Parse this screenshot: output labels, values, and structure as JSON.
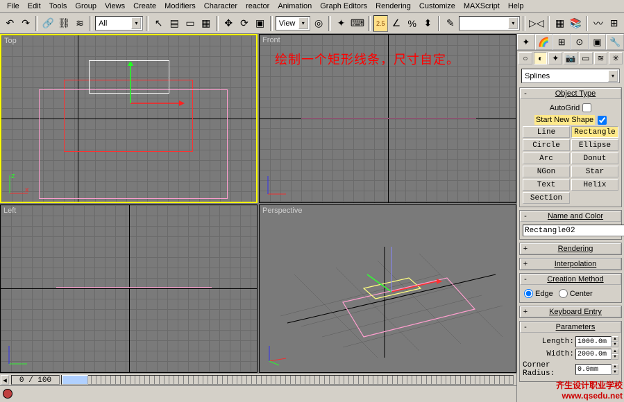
{
  "menu": [
    "File",
    "Edit",
    "Tools",
    "Group",
    "Views",
    "Create",
    "Modifiers",
    "Character",
    "reactor",
    "Animation",
    "Graph Editors",
    "Rendering",
    "Customize",
    "MAXScript",
    "Help"
  ],
  "toolbar": {
    "selset_label": "All",
    "view_label": "View",
    "snap_text": "2.5"
  },
  "viewports": {
    "top": "Top",
    "front": "Front",
    "left": "Left",
    "persp": "Perspective"
  },
  "annotation": "绘制一个矩形线条，尺寸自定。",
  "panel": {
    "category": "Splines",
    "object_type": "Object Type",
    "autogrid": "AutoGrid",
    "start_new_shape": "Start New Shape",
    "buttons": [
      [
        "Line",
        "Rectangle"
      ],
      [
        "Circle",
        "Ellipse"
      ],
      [
        "Arc",
        "Donut"
      ],
      [
        "NGon",
        "Star"
      ],
      [
        "Text",
        "Helix"
      ],
      [
        "Section",
        ""
      ]
    ],
    "selected_button": "Rectangle",
    "name_and_color": "Name and Color",
    "object_name": "Rectangle02",
    "rendering": "Rendering",
    "interpolation": "Interpolation",
    "creation_method": "Creation Method",
    "cm_edge": "Edge",
    "cm_center": "Center",
    "keyboard_entry": "Keyboard Entry",
    "parameters": "Parameters",
    "length_label": "Length:",
    "length_value": "1000.0m",
    "width_label": "Width:",
    "width_value": "2000.0m",
    "corner_label": "Corner Radius:",
    "corner_value": "0.0mm"
  },
  "timeline": {
    "counter": "0 / 100"
  },
  "watermark": {
    "l1": "齐生设计职业学校",
    "l2": "www.qsedu.net"
  }
}
